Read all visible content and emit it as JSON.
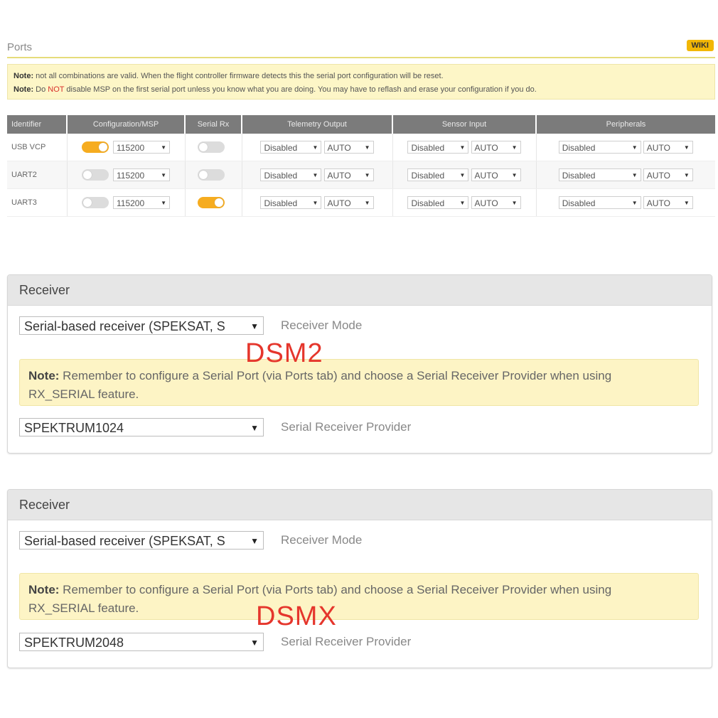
{
  "ports": {
    "title": "Ports",
    "wiki_label": "WIKI",
    "note1_label": "Note:",
    "note1_text": " not all combinations are valid. When the flight controller firmware detects this the serial port configuration will be reset.",
    "note2_label": "Note:",
    "note2_pre": " Do ",
    "note2_not": "NOT",
    "note2_post": " disable MSP on the first serial port unless you know what you are doing. You may have to reflash and erase your configuration if you do.",
    "columns": [
      "Identifier",
      "Configuration/MSP",
      "Serial Rx",
      "Telemetry Output",
      "Sensor Input",
      "Peripherals"
    ],
    "rows": [
      {
        "id": "USB VCP",
        "msp_on": true,
        "baud": "115200",
        "rx_on": false,
        "tel": "Disabled",
        "tel_baud": "AUTO",
        "sens": "Disabled",
        "sens_baud": "AUTO",
        "per": "Disabled",
        "per_baud": "AUTO"
      },
      {
        "id": "UART2",
        "msp_on": false,
        "baud": "115200",
        "rx_on": false,
        "tel": "Disabled",
        "tel_baud": "AUTO",
        "sens": "Disabled",
        "sens_baud": "AUTO",
        "per": "Disabled",
        "per_baud": "AUTO"
      },
      {
        "id": "UART3",
        "msp_on": false,
        "baud": "115200",
        "rx_on": true,
        "tel": "Disabled",
        "tel_baud": "AUTO",
        "sens": "Disabled",
        "sens_baud": "AUTO",
        "per": "Disabled",
        "per_baud": "AUTO"
      }
    ],
    "colors": {
      "toggle_on": "#f6ac1f",
      "header_bg": "#7b7b7b",
      "wiki_bg": "#f2b705"
    }
  },
  "receiver1": {
    "title": "Receiver",
    "mode_value": "Serial-based receiver (SPEKSAT, S",
    "mode_label": "Receiver Mode",
    "tag": "DSM2",
    "note_label": "Note:",
    "note_line1": " Remember to configure a Serial Port (via Ports tab) and choose a Serial Receiver Provider when using",
    "note_line2": "RX_SERIAL feature.",
    "provider_value": "SPEKTRUM1024",
    "provider_label": "Serial Receiver Provider"
  },
  "receiver2": {
    "title": "Receiver",
    "mode_value": "Serial-based receiver (SPEKSAT, S",
    "mode_label": "Receiver Mode",
    "tag": "DSMX",
    "note_label": "Note:",
    "note_line1": " Remember to configure a Serial Port (via Ports tab) and choose a Serial Receiver Provider when using",
    "note_line2": "RX_SERIAL feature.",
    "provider_value": "SPEKTRUM2048",
    "provider_label": "Serial Receiver Provider"
  },
  "tag_color": "#e5362c"
}
